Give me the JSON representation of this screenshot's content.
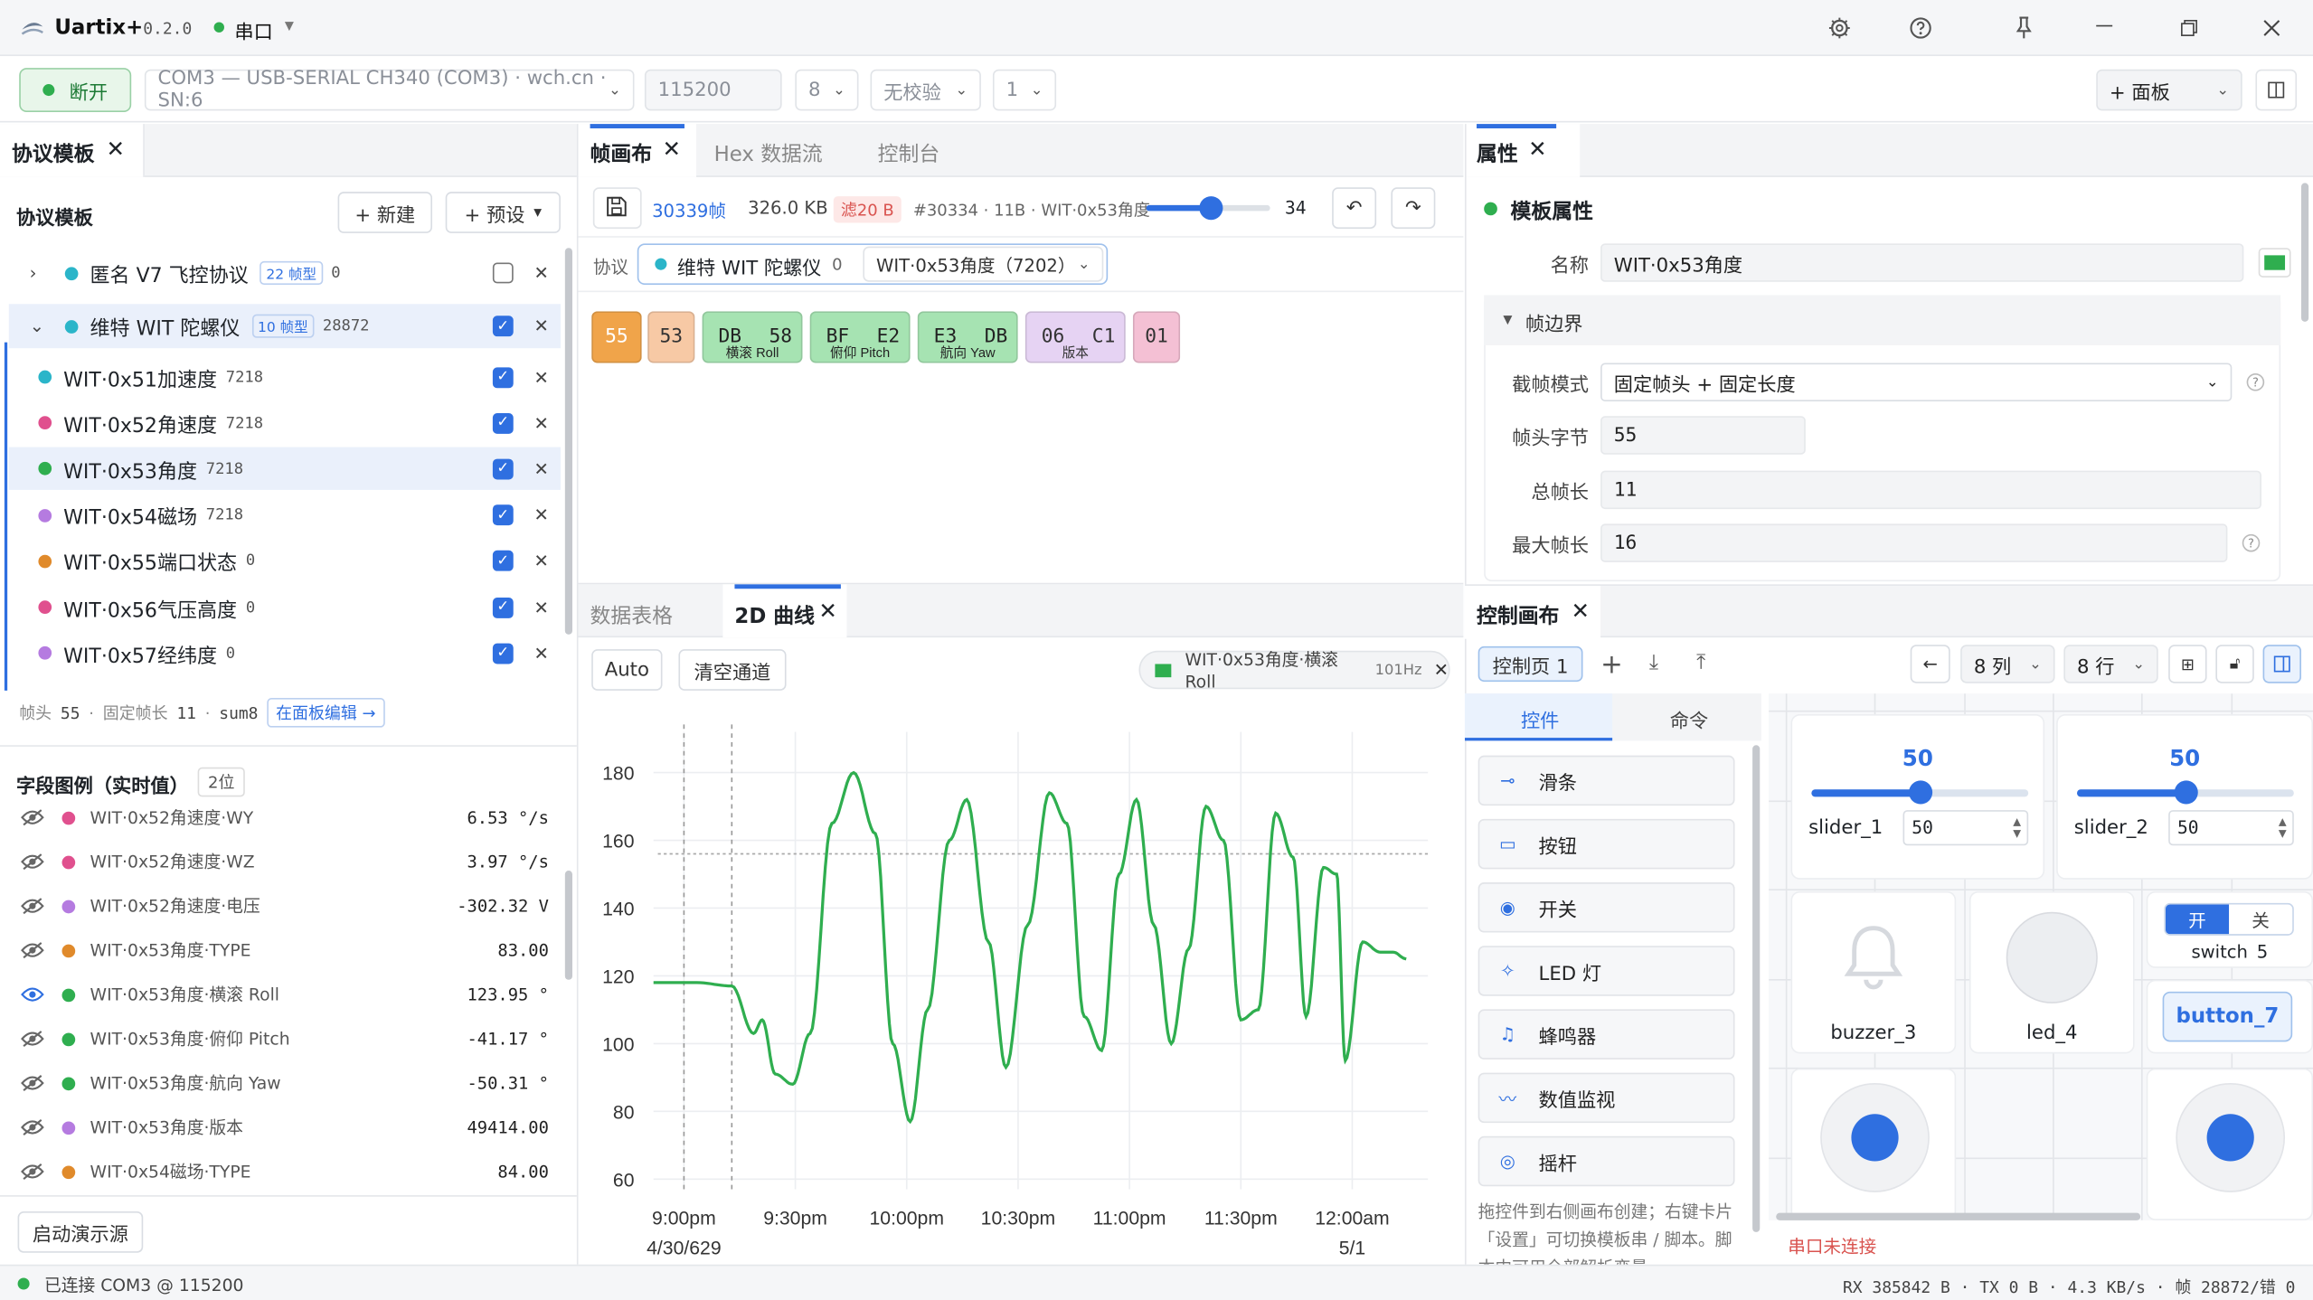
{
  "app": {
    "title": "Uartix+",
    "version": "0.2.0",
    "mode": "串口",
    "accent": "#2f6fe0"
  },
  "toolbar": {
    "disconnect_label": "断开",
    "port": "COM3 — USB-SERIAL CH340 (COM3) · wch.cn · SN:6",
    "baud": "115200",
    "databits": "8",
    "parity": "无校验",
    "stopbits": "1",
    "panel_label": "+ 面板"
  },
  "left": {
    "tab_label": "协议模板",
    "section_title": "协议模板",
    "new_label": "+ 新建",
    "preset_label": "+ 预设",
    "groups": [
      {
        "name": "匿名 V7 飞控协议",
        "badge": "22 帧型",
        "count": "0",
        "color": "#2bb5c9"
      },
      {
        "name": "维特 WIT 陀螺仪",
        "badge": "10 帧型",
        "count": "28872",
        "color": "#2bb5c9"
      }
    ],
    "items": [
      {
        "name": "WIT·0x51加速度",
        "count": "7218",
        "color": "#2bb5c9"
      },
      {
        "name": "WIT·0x52角速度",
        "count": "7218",
        "color": "#e0508e"
      },
      {
        "name": "WIT·0x53角度",
        "count": "7218",
        "color": "#2fae4f"
      },
      {
        "name": "WIT·0x54磁场",
        "count": "7218",
        "color": "#b57be0"
      },
      {
        "name": "WIT·0x55端口状态",
        "count": "0",
        "color": "#e08a2b"
      },
      {
        "name": "WIT·0x56气压高度",
        "count": "0",
        "color": "#e0508e"
      },
      {
        "name": "WIT·0x57经纬度",
        "count": "0",
        "color": "#b57be0"
      }
    ],
    "footer": {
      "head_label": "帧头",
      "head": "55",
      "fixed_label": "固定帧长",
      "len": "11",
      "checksum": "sum8",
      "edit_link": "在面板编辑 →"
    },
    "legend_title": "字段图例（实时值）",
    "legend_count": "2位",
    "legend": [
      {
        "name": "WIT·0x52角速度·WY",
        "value": "6.53 °/s",
        "color": "#e0508e",
        "visible": false
      },
      {
        "name": "WIT·0x52角速度·WZ",
        "value": "3.97 °/s",
        "color": "#e0508e",
        "visible": false
      },
      {
        "name": "WIT·0x52角速度·电压",
        "value": "-302.32 V",
        "color": "#b57be0",
        "visible": false
      },
      {
        "name": "WIT·0x53角度·TYPE",
        "value": "83.00",
        "color": "#e08a2b",
        "visible": false
      },
      {
        "name": "WIT·0x53角度·横滚 Roll",
        "value": "123.95 °",
        "color": "#2fae4f",
        "visible": true
      },
      {
        "name": "WIT·0x53角度·俯仰 Pitch",
        "value": "-41.17 °",
        "color": "#2fae4f",
        "visible": false
      },
      {
        "name": "WIT·0x53角度·航向 Yaw",
        "value": "-50.31 °",
        "color": "#2fae4f",
        "visible": false
      },
      {
        "name": "WIT·0x53角度·版本",
        "value": "49414.00",
        "color": "#b57be0",
        "visible": false
      },
      {
        "name": "WIT·0x54磁场·TYPE",
        "value": "84.00",
        "color": "#e08a2b",
        "visible": false
      }
    ],
    "demo_label": "启动演示源"
  },
  "canvas": {
    "tabs": [
      "帧画布",
      "Hex 数据流",
      "控制台"
    ],
    "frame_count": "30339帧",
    "size": "326.0 KB",
    "filter": "滤20 B",
    "frame_info": "#30334 · 11B · WIT·0x53角度",
    "slider_value": "34",
    "proto_label": "协议",
    "proto_name": "维特 WIT 陀螺仪",
    "proto_count": "0",
    "proto_frame": "WIT·0x53角度（7202）",
    "bytes": [
      {
        "hex": "55",
        "sub": "",
        "bg": "#f0a44a",
        "fg": "#ffffff"
      },
      {
        "hex": "53",
        "sub": "",
        "bg": "#f7c9a5",
        "fg": "#333333"
      },
      {
        "hex1": "DB",
        "hex2": "58",
        "sub": "横滚 Roll",
        "bg": "#a6e3b2",
        "fg": "#222222"
      },
      {
        "hex1": "BF",
        "hex2": "E2",
        "sub": "俯仰 Pitch",
        "bg": "#a6e3b2",
        "fg": "#222222"
      },
      {
        "hex1": "E3",
        "hex2": "DB",
        "sub": "航向 Yaw",
        "bg": "#a6e3b2",
        "fg": "#222222"
      },
      {
        "hex1": "06",
        "hex2": "C1",
        "sub": "版本",
        "bg": "#e6d3f3",
        "fg": "#333333"
      },
      {
        "hex": "01",
        "sub": "",
        "bg": "#f4c0d4",
        "fg": "#333333"
      }
    ]
  },
  "plot": {
    "tabs": [
      "数据表格",
      "2D 曲线"
    ],
    "auto_label": "Auto",
    "clear_label": "清空通道",
    "channel": "WIT·0x53角度·横滚 Roll",
    "rate": "101Hz",
    "x_end_label": "5/1",
    "x_start_label": "4/30/629"
  },
  "chart_data": {
    "type": "line",
    "title": "",
    "xlabel": "",
    "ylabel": "",
    "x_ticks": [
      "9:00pm",
      "9:30pm",
      "10:00pm",
      "10:30pm",
      "11:00pm",
      "11:30pm",
      "12:00am"
    ],
    "y_ticks": [
      180,
      160,
      140,
      120,
      100,
      80,
      60
    ],
    "ylim": [
      57,
      192
    ],
    "grid": true,
    "series": [
      {
        "name": "WIT·0x53角度·横滚 Roll",
        "color": "#2fae4f",
        "x": [
          0.0,
          0.5,
          0.9,
          1.15,
          1.25,
          1.4,
          1.6,
          1.8,
          2.05,
          2.3,
          2.55,
          2.75,
          2.95,
          3.15,
          3.4,
          3.6,
          3.85,
          4.05,
          4.3,
          4.55,
          4.75,
          4.95,
          5.15,
          5.35,
          5.55,
          5.75,
          5.95,
          6.15,
          6.35,
          6.55,
          6.75,
          6.95,
          7.15,
          7.35,
          7.5,
          7.7,
          7.85,
          7.95,
          8.15,
          8.35,
          8.5,
          8.65
        ],
        "y": [
          118,
          118,
          117,
          103,
          107,
          91,
          88,
          103,
          165,
          180,
          162,
          100,
          77,
          110,
          160,
          172,
          130,
          93,
          135,
          174,
          165,
          108,
          98,
          150,
          172,
          135,
          100,
          128,
          170,
          160,
          107,
          110,
          168,
          155,
          108,
          152,
          150,
          95,
          130,
          127,
          127,
          125
        ]
      }
    ]
  },
  "props": {
    "tab_label": "属性",
    "section": "模板属性",
    "name_label": "名称",
    "name_value": "WIT·0x53角度",
    "frame_boundary": "帧边界",
    "mode_label": "截帧模式",
    "mode_value": "固定帧头 + 固定长度",
    "head_label": "帧头字节",
    "head_value": "55",
    "total_label": "总帧长",
    "total_value": "11",
    "max_label": "最大帧长",
    "max_value": "16"
  },
  "control": {
    "tab_label": "控制画布",
    "page_label": "控制页 1",
    "cols": "8 列",
    "rows": "8 行",
    "side_tabs": [
      "控件",
      "命令"
    ],
    "widgets": [
      {
        "name": "滑条",
        "icon": "slider-icon"
      },
      {
        "name": "按钮",
        "icon": "button-icon"
      },
      {
        "name": "开关",
        "icon": "toggle-icon"
      },
      {
        "name": "LED 灯",
        "icon": "led-icon"
      },
      {
        "name": "蜂鸣器",
        "icon": "buzzer-icon"
      },
      {
        "name": "数值监视",
        "icon": "monitor-icon"
      },
      {
        "name": "摇杆",
        "icon": "joystick-icon"
      }
    ],
    "hint": "拖控件到右侧画布创建；右键卡片「设置」可切换模板串 / 脚本。脚本中可用全部解析变量",
    "slider1": {
      "label": "slider_1",
      "value": "50",
      "level": 50
    },
    "slider2": {
      "label": "slider_2",
      "value": "50",
      "level": 50
    },
    "buzzer_label": "buzzer_3",
    "led_label": "led_4",
    "switch_on": "开",
    "switch_off": "关",
    "switch_label": "switch_5",
    "button_label": "button_7",
    "serial_status": "串口未连接"
  },
  "status": {
    "connected": "已连接 COM3 @ 115200",
    "stats": "RX 385842 B · TX 0 B · 4.3 KB/s · 帧 28872/错 0"
  }
}
